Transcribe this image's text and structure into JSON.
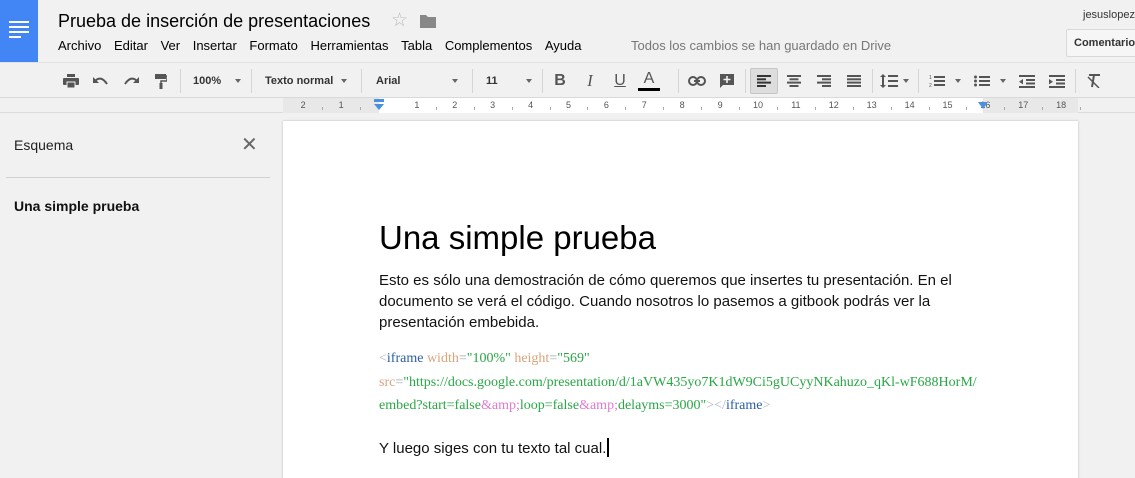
{
  "doc_title": "Prueba de inserción de presentaciones",
  "menu": [
    "Archivo",
    "Editar",
    "Ver",
    "Insertar",
    "Formato",
    "Herramientas",
    "Tabla",
    "Complementos",
    "Ayuda"
  ],
  "save_status": "Todos los cambios se han guardado en Drive",
  "user": "jesuslopez",
  "comments_label": "Comentario",
  "toolbar": {
    "zoom": "100%",
    "style": "Texto normal",
    "font": "Arial",
    "size": "11",
    "bold_glyph": "B",
    "italic_glyph": "I",
    "underline_glyph": "U",
    "textcolor_glyph": "A",
    "text_color": "#000000"
  },
  "ruler_numbers": [
    "2",
    "1",
    "1",
    "2",
    "3",
    "4",
    "5",
    "6",
    "7",
    "8",
    "9",
    "10",
    "11",
    "12",
    "13",
    "14",
    "15",
    "16",
    "17",
    "18"
  ],
  "outline": {
    "title": "Esquema",
    "close_glyph": "✕",
    "items": [
      "Una simple prueba"
    ]
  },
  "document": {
    "heading": "Una simple prueba",
    "paragraph": "Esto es sólo una demostración de cómo queremos que insertes tu presentación. En el documento se verá el código. Cuando nosotros lo pasemos a gitbook podrás ver la presentación embebida.",
    "code": {
      "lt": "<",
      "tag": "iframe",
      "width_attr": "width",
      "eq": "=",
      "width_val": "\"100%\"",
      "height_attr": "height",
      "height_val": "\"569\"",
      "src_attr": "src",
      "src_val_1": "\"https://docs.google.com/presentation/d/1aVW435yo7K1dW9Ci5gUCyyNKahuzo_qKl-wF688HorM/",
      "src_val_2": "embed?start=false",
      "amp": "&amp;",
      "src_val_3": "loop=false",
      "src_val_4": "delayms=3000\"",
      "gt": ">",
      "close_lt": "</",
      "close_tag": "iframe",
      "close_gt": ">"
    },
    "last_line": "Y luego siges con tu texto tal cual."
  },
  "colors": {
    "brand_blue": "#4285f4",
    "tag": "#2c5ea8",
    "attr": "#d9a37b",
    "value": "#28a745",
    "entity": "#e07ad0"
  }
}
